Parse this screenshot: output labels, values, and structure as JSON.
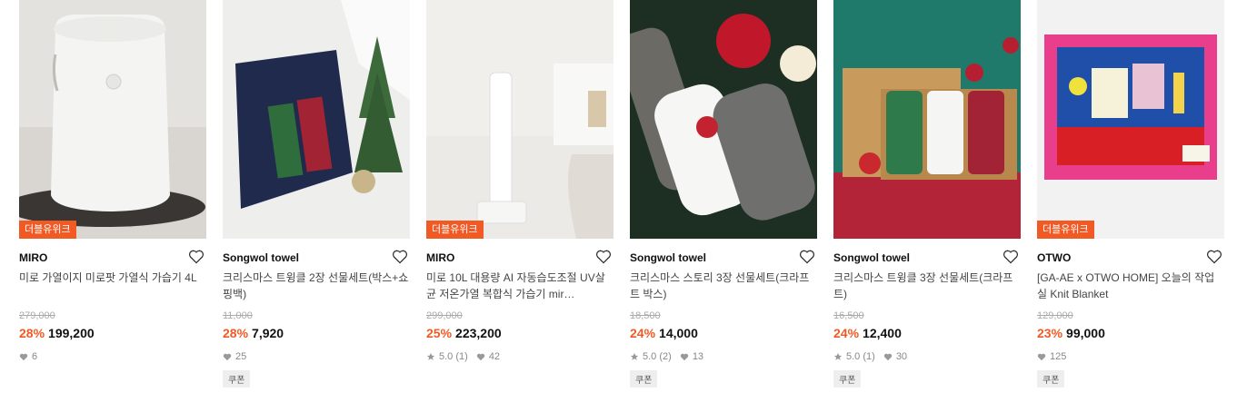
{
  "products": [
    {
      "brand": "MIRO",
      "title": "미로 가열이지 미로팟 가열식 가습기 4L",
      "original_price": "279,000",
      "discount": "28%",
      "price": "199,200",
      "rating": "",
      "reviews": "",
      "likes": "6",
      "badge": "더블유위크",
      "coupon": ""
    },
    {
      "brand": "Songwol towel",
      "title": "크리스마스 트윙클 2장 선물세트(박스+쇼핑백)",
      "original_price": "11,000",
      "discount": "28%",
      "price": "7,920",
      "rating": "",
      "reviews": "",
      "likes": "25",
      "badge": "",
      "coupon": "쿠폰"
    },
    {
      "brand": "MIRO",
      "title": "미로 10L 대용량 AI 자동습도조절 UV살균 저온가열 복합식 가습기 mir…",
      "original_price": "299,000",
      "discount": "25%",
      "price": "223,200",
      "rating": "5.0",
      "reviews": "(1)",
      "likes": "42",
      "badge": "더블유위크",
      "coupon": ""
    },
    {
      "brand": "Songwol towel",
      "title": "크리스마스 스토리 3장 선물세트(크라프트 박스)",
      "original_price": "18,500",
      "discount": "24%",
      "price": "14,000",
      "rating": "5.0",
      "reviews": "(2)",
      "likes": "13",
      "badge": "",
      "coupon": "쿠폰"
    },
    {
      "brand": "Songwol towel",
      "title": "크리스마스 트윙클 3장 선물세트(크라프트)",
      "original_price": "16,500",
      "discount": "24%",
      "price": "12,400",
      "rating": "5.0",
      "reviews": "(1)",
      "likes": "30",
      "badge": "",
      "coupon": "쿠폰"
    },
    {
      "brand": "OTWO",
      "title": "[GA-AE x OTWO HOME] 오늘의 작업실 Knit Blanket",
      "original_price": "129,000",
      "discount": "23%",
      "price": "99,000",
      "rating": "",
      "reviews": "",
      "likes": "125",
      "badge": "더블유위크",
      "coupon": "쿠폰"
    }
  ],
  "colors": {
    "accent": "#f15a24",
    "stat_icon": "#999999"
  }
}
